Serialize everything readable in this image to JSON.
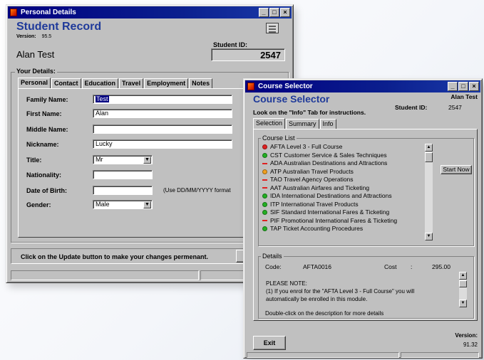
{
  "personal_window": {
    "title": "Personal Details",
    "heading": "Student Record",
    "version_label": "Version:",
    "version_value": "95.5",
    "student_id_label": "Student ID:",
    "student_id_value": "2547",
    "student_name": "Alan  Test",
    "your_details_label": "Your Details:",
    "tabs": [
      "Personal",
      "Contact",
      "Education",
      "Travel",
      "Employment",
      "Notes"
    ],
    "fields": {
      "family_name": {
        "label": "Family Name:",
        "value": "Test"
      },
      "first_name": {
        "label": "First Name:",
        "value": "Alan"
      },
      "middle_name": {
        "label": "Middle Name:",
        "value": ""
      },
      "nickname": {
        "label": "Nickname:",
        "value": "Lucky"
      },
      "title": {
        "label": "Title:",
        "value": "Mr"
      },
      "nationality": {
        "label": "Nationality:",
        "value": ""
      },
      "dob": {
        "label": "Date of Birth:",
        "value": "",
        "hint": "(Use DD/MM/YYYY format"
      },
      "gender": {
        "label": "Gender:",
        "value": "Male"
      }
    },
    "update_hint": "Click on the Update button to make your changes permenant."
  },
  "course_window": {
    "title": "Course Selector",
    "heading": "Course Selector",
    "student_name": "Alan Test",
    "student_id_label": "Student ID:",
    "student_id_value": "2547",
    "instruction": "Look on the \"Info\" Tab for instructions.",
    "tabs": [
      "Selection",
      "Summary",
      "Info"
    ],
    "course_list_label": "Course List",
    "courses": [
      {
        "status": "red-dot",
        "color": "#e02020",
        "text": "AFTA Level 3 - Full Course"
      },
      {
        "status": "green-dot",
        "color": "#22b022",
        "text": "CST  Customer Service & Sales Techniques"
      },
      {
        "status": "red-dash",
        "color": "#e02020",
        "text": "ADA  Australian Destinations and Attractions"
      },
      {
        "status": "orange-dot",
        "color": "#f0a020",
        "text": "ATP  Australian Travel Products"
      },
      {
        "status": "red-dash",
        "color": "#e02020",
        "text": "TAO  Travel Agency Operations"
      },
      {
        "status": "red-dash",
        "color": "#e02020",
        "text": "AAT  Australian Airfares and Ticketing"
      },
      {
        "status": "green-dot",
        "color": "#22b022",
        "text": "IDA  International Destinations and Attractions"
      },
      {
        "status": "green-dot",
        "color": "#22b022",
        "text": "ITP  International Travel Products"
      },
      {
        "status": "green-dot",
        "color": "#22b022",
        "text": "SIF  Standard International Fares & Ticketing"
      },
      {
        "status": "red-dash",
        "color": "#e02020",
        "text": "PIF  Promotional International Fares & Ticketing"
      },
      {
        "status": "green-dot",
        "color": "#22b022",
        "text": "TAP  Ticket Accounting Procedures"
      }
    ],
    "start_now_label": "Start Now",
    "details_label": "Details",
    "code_label": "Code:",
    "code_value": "AFTA0016",
    "cost_label": "Cost",
    "cost_sep": ":",
    "cost_value": "295.00",
    "note_lines": [
      "PLEASE NOTE:",
      "(1)  If you enrol for the \"AFTA Level 3 - Full Course\" you will",
      "automatically be enrolled in this module."
    ],
    "details_footer": "Double-click on the description for more details",
    "exit_label": "Exit",
    "version_label": "Version:",
    "version_value": "91.32"
  }
}
